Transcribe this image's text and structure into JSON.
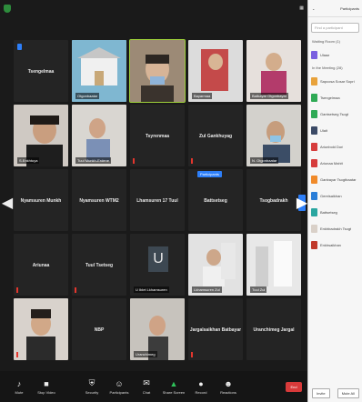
{
  "window": {
    "title": "Participants"
  },
  "grid": {
    "row1": [
      "Tsengelmaa",
      "Otgonbaatar",
      "Yanjmaa",
      "Bayarmaa",
      "Batbayar Otgonbayar"
    ],
    "row2": [
      "S.Enkhtuya",
      "Tuul Munkh-Erdene",
      "Tsyrenmaa",
      "Zul Gankhuyag",
      "N. Otgonbaatar"
    ],
    "row3": [
      "Nyamsuren Munkh",
      "Nyamsuren WTM2",
      "Lhamsuren 17 Tuul",
      "Battsetseg",
      "Tsogbadrakh"
    ],
    "row4": [
      "Ariunaa",
      "Tuul Tsetseg",
      "U Iblet Lkhamsuren",
      "Lkhamsuren Zul",
      "Tuul Zul"
    ],
    "row5": [
      "Angar",
      "NBP",
      "Uranchimeg",
      "Jargalsaikhan Batbayar",
      "Uranchimeg Jargal"
    ],
    "pin_label": "Participants"
  },
  "toolbar": {
    "mute": "Mute",
    "video": "Stop Video",
    "security": "Security",
    "participants": "Participants",
    "chat": "Chat",
    "share": "Share Screen",
    "record": "Record",
    "reactions": "Reactions",
    "end": "End"
  },
  "panel": {
    "title": "Participants",
    "search_placeholder": "Find a participant",
    "waiting_header": "Waiting Room (1)",
    "waiting_list": [
      "Ulaaa"
    ],
    "meeting_header": "In the Meeting (28)",
    "participants": [
      "Sapcosa Sosar Sopri",
      "Tsengelmaa",
      "Gantsetseg Tsogt",
      "Ulalt",
      "Ariunbold Dori",
      "Ariunaa Mahit",
      "Ganbayar Tsogtbaatar",
      "Gerelsaikhan",
      "Battsetseg",
      "Enkhbadrakh Tsogt",
      "Enkhsaikhan"
    ],
    "invite": "Invite",
    "mute_all": "Mute All"
  },
  "colors": {
    "accent": "#2d7ff9",
    "active_border": "#9fd23a",
    "end_red": "#d83a3a"
  }
}
